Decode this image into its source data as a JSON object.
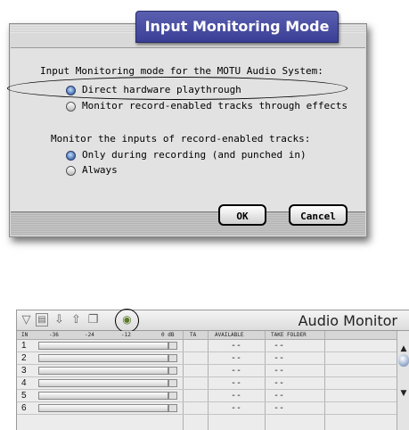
{
  "dialog": {
    "title": "Input Monitoring Mode",
    "group1_label": "Input Monitoring mode for the MOTU Audio System:",
    "group1_options": [
      {
        "label": "Direct hardware playthrough",
        "checked": true
      },
      {
        "label": "Monitor record-enabled tracks through effects",
        "checked": false
      }
    ],
    "group2_label": "Monitor the inputs of record-enabled tracks:",
    "group2_options": [
      {
        "label": "Only during recording (and punched in)",
        "checked": true
      },
      {
        "label": "Always",
        "checked": false
      }
    ],
    "ok_label": "OK",
    "cancel_label": "Cancel"
  },
  "monitor": {
    "title": "Audio Monitor",
    "columns": {
      "in": "IN",
      "scale": [
        "-36",
        "-24",
        "-12",
        "0 dB"
      ],
      "ta": "TA",
      "available": "AVAILABLE",
      "take_folder": "TAKE FOLDER"
    },
    "rows": [
      {
        "num": "1",
        "available": "--",
        "take_folder": "--"
      },
      {
        "num": "2",
        "available": "--",
        "take_folder": "--"
      },
      {
        "num": "3",
        "available": "--",
        "take_folder": "--"
      },
      {
        "num": "4",
        "available": "--",
        "take_folder": "--"
      },
      {
        "num": "5",
        "available": "--",
        "take_folder": "--"
      },
      {
        "num": "6",
        "available": "--",
        "take_folder": "--"
      }
    ],
    "toolbar_icons": [
      "triangle-down-icon",
      "document-icon",
      "arrow-down-icon",
      "arrow-up-icon",
      "windows-icon",
      "input-monitor-icon"
    ]
  }
}
